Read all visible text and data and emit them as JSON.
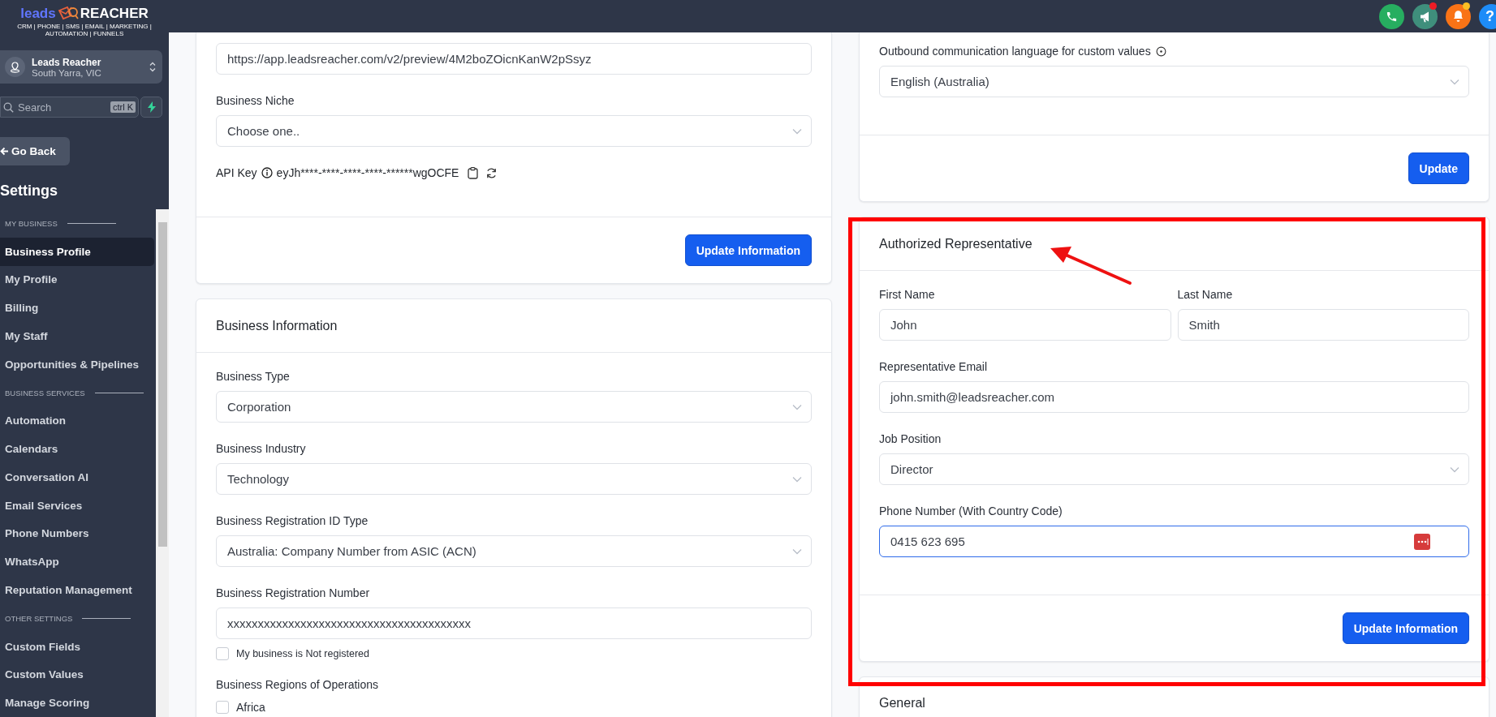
{
  "logo": {
    "word_1": "leads",
    "word_2": "REACHER",
    "tagline": "CRM | PHONE | SMS | EMAIL | MARKETING | AUTOMATION | FUNNELS"
  },
  "account": {
    "name": "Leads Reacher",
    "location": "South Yarra, VIC"
  },
  "search": {
    "placeholder": "Search",
    "shortcut": "ctrl K"
  },
  "back_button": "Go Back",
  "sidebar": {
    "title": "Settings",
    "sections": [
      {
        "heading": "MY BUSINESS",
        "items": [
          {
            "label": "Business Profile",
            "selected": true
          },
          {
            "label": "My Profile",
            "selected": false
          },
          {
            "label": "Billing",
            "selected": false
          },
          {
            "label": "My Staff",
            "selected": false
          },
          {
            "label": "Opportunities & Pipelines",
            "selected": false
          }
        ]
      },
      {
        "heading": "BUSINESS SERVICES",
        "items": [
          {
            "label": "Automation",
            "selected": false
          },
          {
            "label": "Calendars",
            "selected": false
          },
          {
            "label": "Conversation AI",
            "selected": false
          },
          {
            "label": "Email Services",
            "selected": false
          },
          {
            "label": "Phone Numbers",
            "selected": false
          },
          {
            "label": "WhatsApp",
            "selected": false
          },
          {
            "label": "Reputation Management",
            "selected": false
          }
        ]
      },
      {
        "heading": "OTHER SETTINGS",
        "items": [
          {
            "label": "Custom Fields",
            "selected": false
          },
          {
            "label": "Custom Values",
            "selected": false
          },
          {
            "label": "Manage Scoring",
            "selected": false
          }
        ]
      }
    ]
  },
  "header_icons": [
    {
      "kind": "phone",
      "color": "#27ae60"
    },
    {
      "kind": "megaphone",
      "color": "#3f8f7c",
      "dot": {
        "color": "#ee1c25"
      }
    },
    {
      "kind": "bell",
      "color": "#f97316",
      "dot": {
        "color": "#fbbf24"
      }
    },
    {
      "kind": "help",
      "color": "#1d8cf8",
      "label": "?"
    }
  ],
  "left_column": [
    {
      "fields": [
        {
          "kind": "input",
          "value": "https://app.leadsreacher.com/v2/preview/4M2boZOicnKanW2pSsyz"
        },
        {
          "kind": "select",
          "label": "Business Niche",
          "value": "Choose one.."
        },
        {
          "kind": "api_key",
          "label": "API Key",
          "value": "eyJh****-****-****-****-******wgOCFE"
        }
      ],
      "button": "Update Information"
    },
    {
      "title": "Business Information",
      "fields": [
        {
          "kind": "select",
          "label": "Business Type",
          "value": "Corporation"
        },
        {
          "kind": "select",
          "label": "Business Industry",
          "value": "Technology"
        },
        {
          "kind": "select",
          "label": "Business Registration ID Type",
          "value": "Australia: Company Number from ASIC (ACN)"
        },
        {
          "kind": "input",
          "label": "Business Registration Number",
          "value": "xxxxxxxxxxxxxxxxxxxxxxxxxxxxxxxxxxxxxxxx"
        },
        {
          "kind": "checkbox",
          "label": "My business is Not registered",
          "checked": false
        },
        {
          "kind": "heading",
          "label": "Business Regions of Operations"
        },
        {
          "kind": "checkbox",
          "label": "Africa",
          "checked": false
        }
      ]
    }
  ],
  "right_column": [
    {
      "fields": [
        {
          "kind": "select",
          "label": "Outbound communication language for custom values",
          "info": true,
          "value": "English (Australia)"
        }
      ],
      "button": "Update"
    },
    {
      "title": "Authorized Representative",
      "highlighted": true,
      "fields": [
        {
          "kind": "pair",
          "items": [
            {
              "kind": "input",
              "label": "First Name",
              "value": "John"
            },
            {
              "kind": "input",
              "label": "Last Name",
              "value": "Smith"
            }
          ]
        },
        {
          "kind": "input",
          "label": "Representative Email",
          "value": "john.smith@leadsreacher.com"
        },
        {
          "kind": "select",
          "label": "Job Position",
          "value": "Director"
        },
        {
          "kind": "input",
          "label": "Phone Number (With Country Code)",
          "value": "0415 623 695",
          "focused": true
        }
      ],
      "button": "Update Information"
    },
    {
      "title": "General"
    }
  ]
}
